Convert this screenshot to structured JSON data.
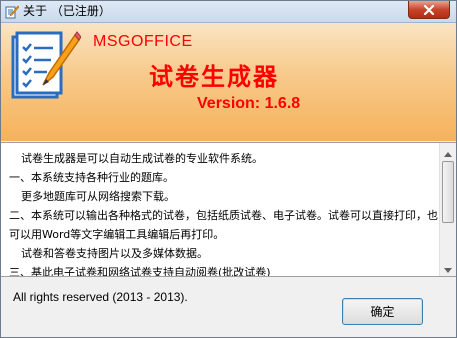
{
  "window": {
    "title": "关于 （已注册）"
  },
  "banner": {
    "brand": "MSGOFFICE",
    "product_name": "试卷生成器",
    "version": "Version:  1.6.8"
  },
  "description": {
    "lines": [
      "试卷生成器是可以自动生成试卷的专业软件系统。",
      "一、本系统支持各种行业的题库。",
      "更多地题库可从网络搜索下载。",
      "二、本系统可以输出各种格式的试卷，包括纸质试卷、电子试卷。试卷可以直接打印，也可以用Word等文字编辑工具编辑后再打印。",
      "试卷和答卷支持图片以及多媒体数据。",
      "三、基此电子试卷和网络试卷支持自动阅卷(批改试卷)"
    ]
  },
  "footer": {
    "copyright": "All rights reserved (2013 - 2013).",
    "ok_label": "确定"
  },
  "icons": {
    "app": "document-pencil-icon",
    "close": "close-icon",
    "logo": "document-pencil-logo",
    "scroll_up": "chevron-up-icon",
    "scroll_down": "chevron-down-icon"
  },
  "colors": {
    "accent_text": "#ff0000",
    "banner_top": "#fae4c4",
    "banner_bottom": "#f5b25b",
    "close_button": "#c7452c"
  }
}
